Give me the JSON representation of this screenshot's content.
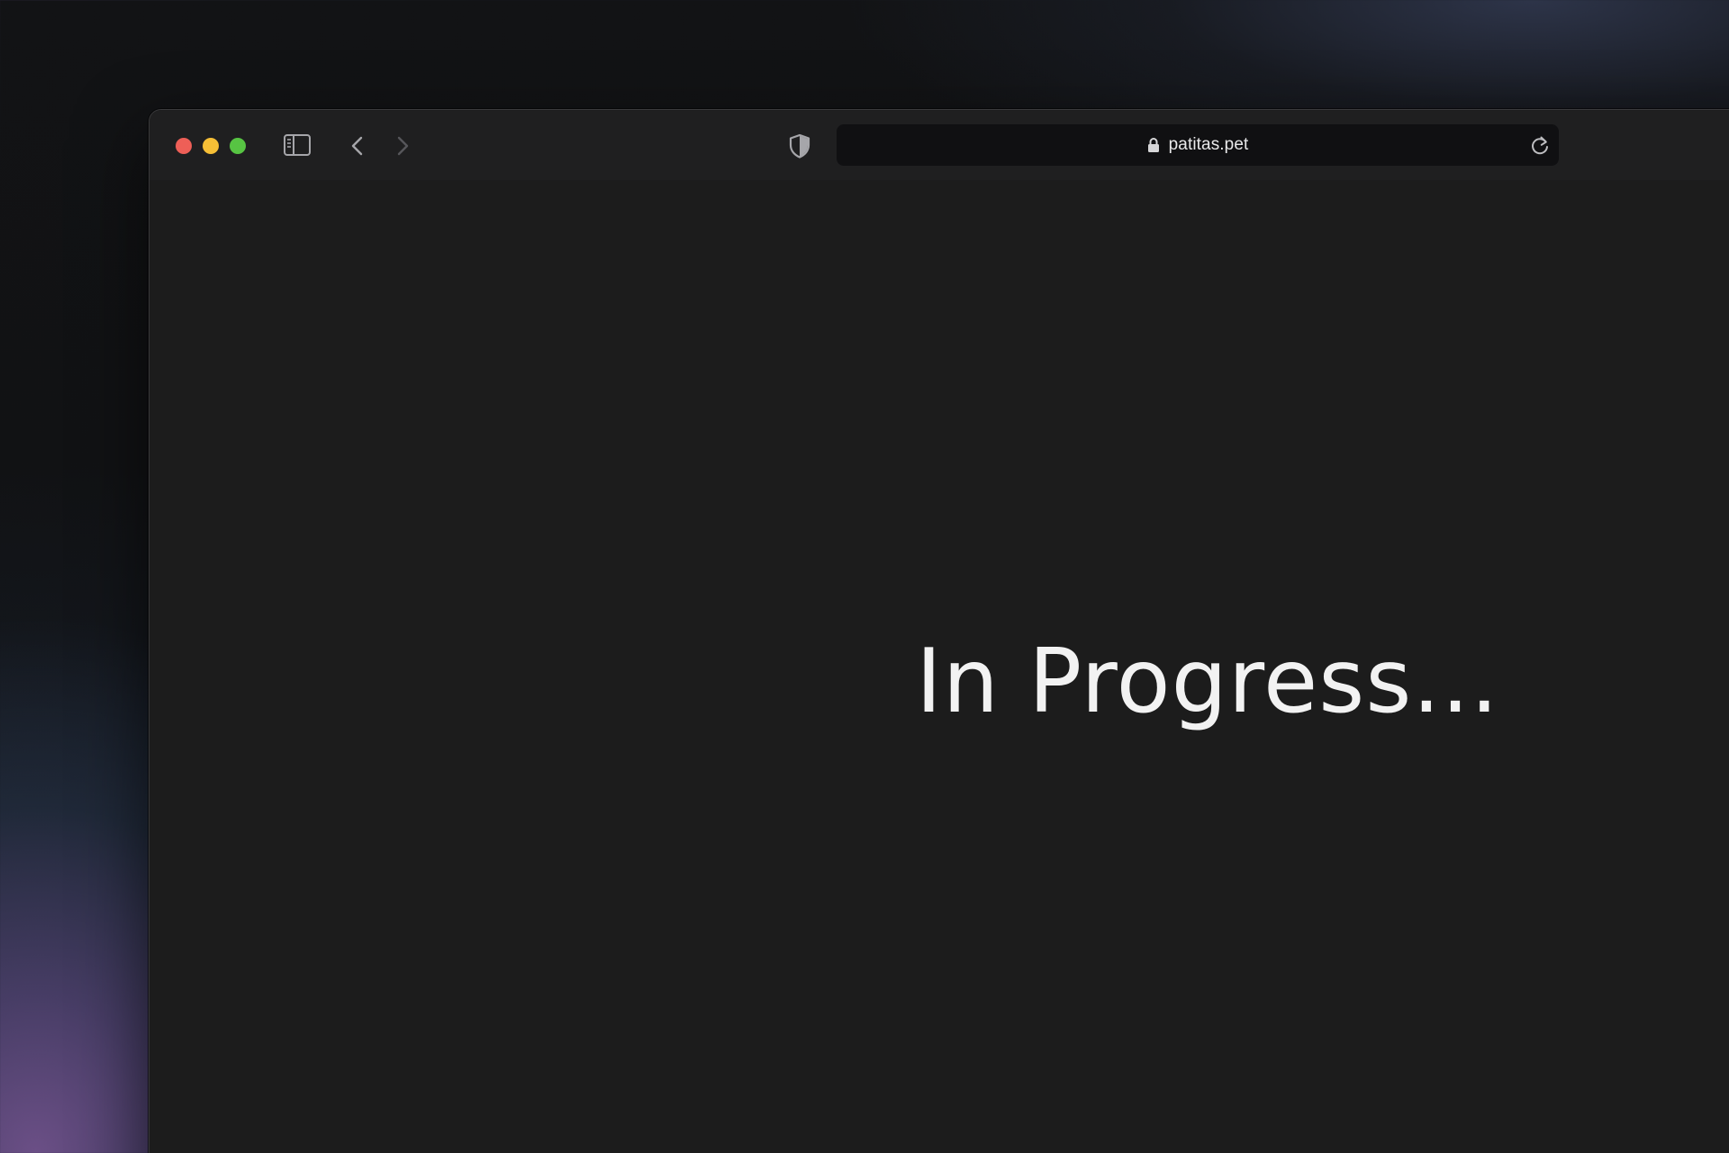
{
  "browser": {
    "address_bar": {
      "url": "patitas.pet",
      "secure": true
    },
    "toolbar": {
      "icons": [
        "sidebar-toggle-icon",
        "back-arrow-icon",
        "forward-arrow-icon",
        "privacy-shield-icon",
        "lock-icon",
        "reload-icon"
      ],
      "forward_enabled": false
    },
    "traffic_lights": {
      "close_color": "#ee5f57",
      "minimize_color": "#f6bf36",
      "maximize_color": "#57c443"
    }
  },
  "page": {
    "headline": "In Progress..."
  },
  "colors": {
    "window_background": "#1c1c1c",
    "toolbar_background": "#1f1f20",
    "urlbar_background": "#101012",
    "headline_color": "#f2f2f2"
  }
}
